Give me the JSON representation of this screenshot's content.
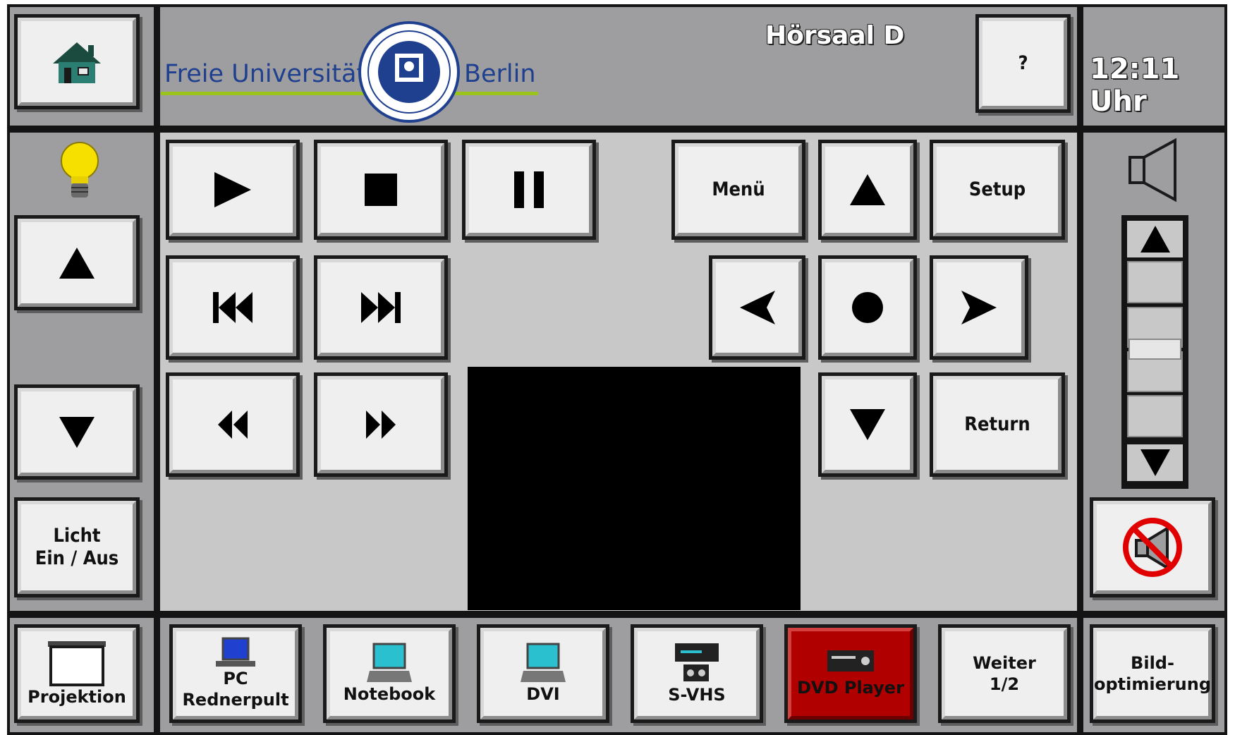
{
  "header": {
    "room_title": "Hörsaal D",
    "logo_left_text": "Freie Universität",
    "logo_right_text": "Berlin",
    "help_label": "?",
    "clock": "12:11 Uhr"
  },
  "light": {
    "label_line1": "Licht",
    "label_line2": "Ein / Aus"
  },
  "dvd_controls": {
    "menu_label": "Menü",
    "setup_label": "Setup",
    "return_label": "Return"
  },
  "volume": {
    "level": 0.5
  },
  "sources": [
    {
      "label": "Projektion"
    },
    {
      "label_line1": "PC",
      "label_line2": "Rednerpult"
    },
    {
      "label": "Notebook"
    },
    {
      "label": "DVI"
    },
    {
      "label": "S-VHS"
    },
    {
      "label": "DVD Player",
      "active": true
    },
    {
      "label_line1": "Weiter",
      "label_line2": "1/2"
    },
    {
      "label_line1": "Bild-",
      "label_line2": "optimierung"
    }
  ],
  "colors": {
    "panel_bg": "#9e9ea0",
    "content_bg": "#c8c8c8",
    "button_face": "#efefef",
    "active_source": "#b00000",
    "logo_blue": "#1f3f8f",
    "logo_green": "#9ac31c"
  }
}
